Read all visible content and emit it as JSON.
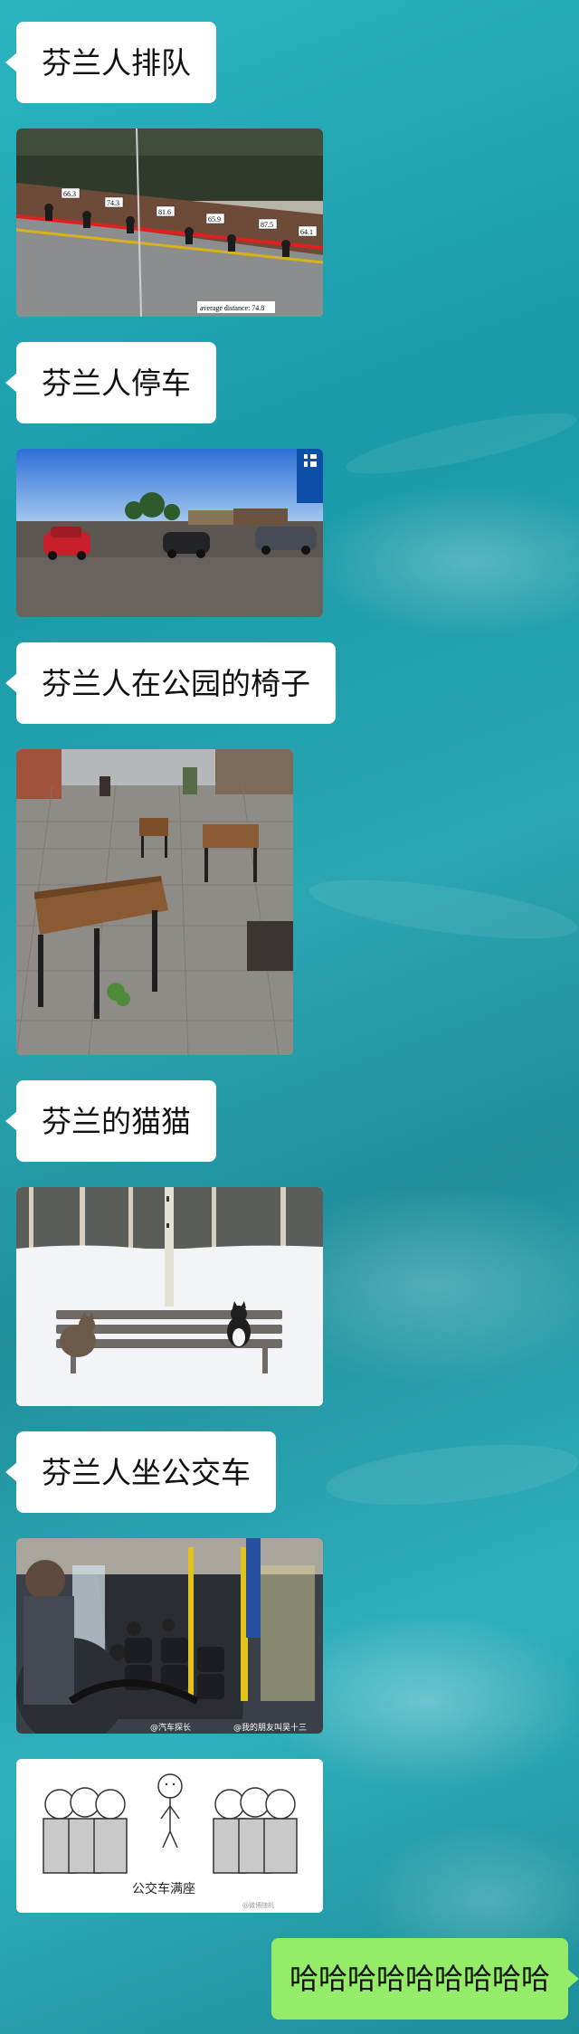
{
  "messages": [
    {
      "type": "text",
      "text": "芬兰人排队"
    },
    {
      "type": "image",
      "description_id": "queue"
    },
    {
      "type": "text",
      "text": "芬兰人停车"
    },
    {
      "type": "image",
      "description_id": "parking"
    },
    {
      "type": "text",
      "text": "芬兰人在公园的椅子"
    },
    {
      "type": "image",
      "description_id": "benches"
    },
    {
      "type": "text",
      "text": "芬兰的猫猫"
    },
    {
      "type": "image",
      "description_id": "cats"
    },
    {
      "type": "text",
      "text": "芬兰人坐公交车"
    },
    {
      "type": "image",
      "description_id": "bus"
    },
    {
      "type": "image",
      "description_id": "cartoon"
    },
    {
      "type": "text",
      "text": "哈哈哈哈哈哈哈哈哈"
    }
  ],
  "queue_image": {
    "distances": [
      "66.3",
      "74.3",
      "81.6",
      "65.9",
      "87.5",
      "64.1"
    ],
    "average_label": "average distance: 74.8"
  },
  "bus_image": {
    "watermark_left": "@汽车探长",
    "watermark_right": "@我的朋友叫吴十三"
  },
  "cartoon_image": {
    "caption": "公交车满座",
    "watermark": "@微博随机"
  }
}
